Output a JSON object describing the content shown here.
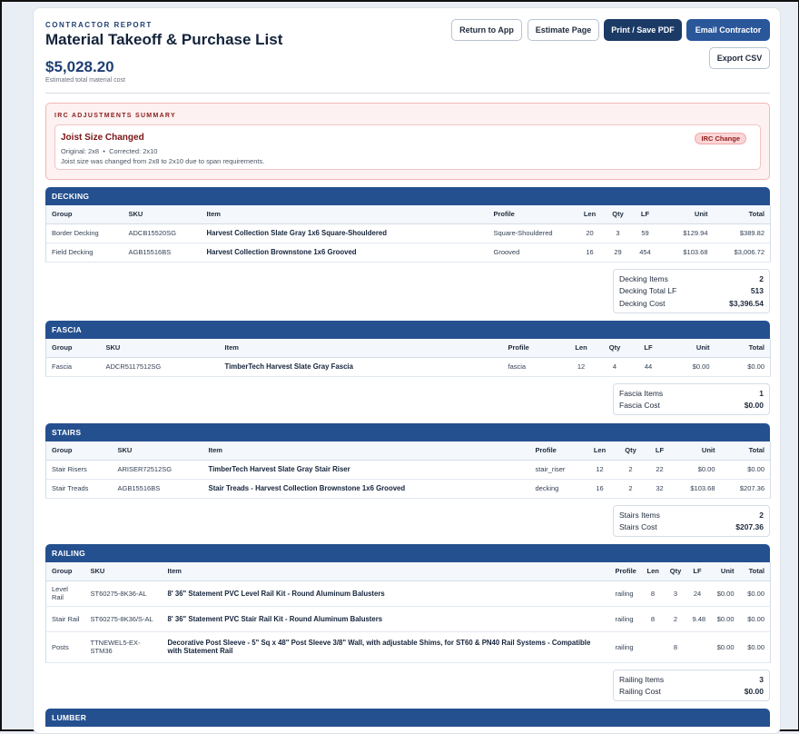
{
  "header": {
    "eyebrow": "CONTRACTOR REPORT",
    "title": "Material Takeoff & Purchase List",
    "total": "$5,028.20",
    "total_label": "Estimated total material cost"
  },
  "buttons": {
    "return": "Return to App",
    "estimate": "Estimate Page",
    "print": "Print / Save PDF",
    "email": "Email Contractor",
    "export": "Export CSV"
  },
  "irc": {
    "heading": "IRC ADJUSTMENTS SUMMARY",
    "title": "Joist Size Changed",
    "original": "Original: 2x8",
    "bullet": "•",
    "corrected": "Corrected: 2x10",
    "note": "Joist size was changed from 2x8 to 2x10 due to span requirements.",
    "badge": "IRC Change"
  },
  "columns": [
    "Group",
    "SKU",
    "Item",
    "Profile",
    "Len",
    "Qty",
    "LF",
    "Unit",
    "Total"
  ],
  "sections": {
    "decking": {
      "title": "DECKING",
      "rows": [
        [
          "Border Decking",
          "ADCB15520SG",
          "Harvest Collection Slate Gray 1x6 Square-Shouldered",
          "Square-Shouldered",
          "20",
          "3",
          "59",
          "$129.94",
          "$389.82"
        ],
        [
          "Field Decking",
          "AGB15516BS",
          "Harvest Collection Brownstone 1x6 Grooved",
          "Grooved",
          "16",
          "29",
          "454",
          "$103.68",
          "$3,006.72"
        ]
      ],
      "summary": [
        [
          "Decking Items",
          "2"
        ],
        [
          "Decking Total LF",
          "513"
        ],
        [
          "Decking Cost",
          "$3,396.54"
        ]
      ]
    },
    "fascia": {
      "title": "FASCIA",
      "rows": [
        [
          "Fascia",
          "ADCR5117512SG",
          "TimberTech Harvest Slate Gray Fascia",
          "fascia",
          "12",
          "4",
          "44",
          "$0.00",
          "$0.00"
        ]
      ],
      "summary": [
        [
          "Fascia Items",
          "1"
        ],
        [
          "Fascia Cost",
          "$0.00"
        ]
      ]
    },
    "stairs": {
      "title": "STAIRS",
      "rows": [
        [
          "Stair Risers",
          "ARISER72512SG",
          "TimberTech Harvest Slate Gray Stair Riser",
          "stair_riser",
          "12",
          "2",
          "22",
          "$0.00",
          "$0.00"
        ],
        [
          "Stair Treads",
          "AGB15516BS",
          "Stair Treads - Harvest Collection Brownstone 1x6 Grooved",
          "decking",
          "16",
          "2",
          "32",
          "$103.68",
          "$207.36"
        ]
      ],
      "summary": [
        [
          "Stairs Items",
          "2"
        ],
        [
          "Stairs Cost",
          "$207.36"
        ]
      ]
    },
    "railing": {
      "title": "RAILING",
      "rows": [
        [
          "Level Rail",
          "ST60275-8K36-AL",
          "8' 36\" Statement PVC Level Rail Kit - Round Aluminum Balusters",
          "railing",
          "8",
          "3",
          "24",
          "$0.00",
          "$0.00"
        ],
        [
          "Stair Rail",
          "ST60275-8K36/S-AL",
          "8' 36\" Statement PVC Stair Rail Kit - Round Aluminum Balusters",
          "railing",
          "8",
          "2",
          "9.48",
          "$0.00",
          "$0.00"
        ],
        [
          "Posts",
          "TTNEWEL5-EX-STM36",
          "Decorative Post Sleeve - 5\" Sq x 48\" Post Sleeve 3/8\" Wall, with adjustable Shims, for ST60 & PN40 Rail Systems - Compatible with Statement Rail",
          "railing",
          "",
          "8",
          "",
          "$0.00",
          "$0.00"
        ]
      ],
      "summary": [
        [
          "Railing Items",
          "3"
        ],
        [
          "Railing Cost",
          "$0.00"
        ]
      ]
    },
    "lumber": {
      "title": "LUMBER"
    }
  }
}
